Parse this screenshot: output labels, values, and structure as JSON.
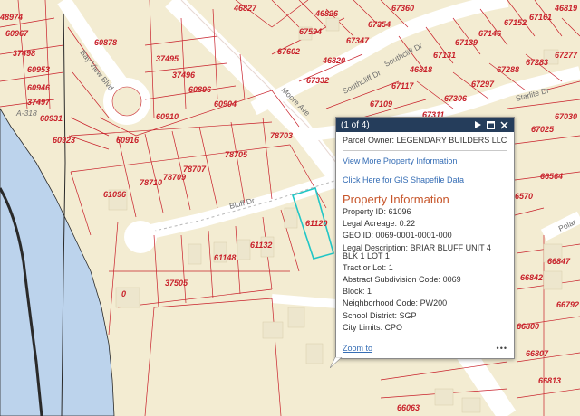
{
  "map": {
    "parcel_labels": [
      "46827",
      "46826",
      "67360",
      "46819",
      "67161",
      "67152",
      "67354",
      "67594",
      "67347",
      "67602",
      "46820",
      "67146",
      "67139",
      "67131",
      "67277",
      "67288",
      "67283",
      "67332",
      "46818",
      "67297",
      "67306",
      "67117",
      "67109",
      "67311",
      "67030",
      "67025",
      "66564",
      "6570",
      "66847",
      "66842",
      "66792",
      "66800",
      "66807",
      "66813",
      "66063",
      "48974",
      "60967",
      "37498",
      "60953",
      "60946",
      "37497",
      "60931",
      "60923",
      "60878",
      "37495",
      "37496",
      "60896",
      "60904",
      "60910",
      "60916",
      "78703",
      "78705",
      "78707",
      "78709",
      "78710",
      "61096",
      "61120",
      "61132",
      "61148",
      "37505",
      "0"
    ],
    "street_labels": [
      "Bay View Blvd",
      "Southcliff Dr",
      "Southcliff Dr",
      "Moore Ave",
      "Starlite Dr",
      "Bluff Dr",
      "Polar",
      "A-318"
    ]
  },
  "popup": {
    "count": "(1 of 4)",
    "owner_label": "Parcel Owner:",
    "owner_value": "LEGENDARY BUILDERS LLC",
    "link_view_more": "View More Property Information",
    "link_shapefile": "Click Here for GIS Shapefile Data",
    "heading": "Property Information",
    "fields": [
      {
        "label": "Property ID:",
        "value": "61096"
      },
      {
        "label": "Legal Acreage:",
        "value": "0.22"
      },
      {
        "label": "GEO ID:",
        "value": "0069-0001-0001-000"
      },
      {
        "label": "Legal Description:",
        "value": "BRIAR BLUFF UNIT 4 BLK 1 LOT 1"
      },
      {
        "label": "Tract or Lot:",
        "value": "1"
      },
      {
        "label": "Abstract Subdivision Code:",
        "value": "0069"
      },
      {
        "label": "Block:",
        "value": "1"
      },
      {
        "label": "Neighborhood Code:",
        "value": "PW200"
      },
      {
        "label": "School District:",
        "value": "SGP"
      },
      {
        "label": "City Limits:",
        "value": "CPO"
      }
    ],
    "zoom_label": "Zoom to",
    "more_label": "•••"
  },
  "colors": {
    "water": "#bcd3ec",
    "land": "#f3ecd2",
    "road": "#ffffff",
    "parcel_line": "#c8202a",
    "building": "#ede6cd",
    "selected": "#21c6c6",
    "popup_header": "#253d5b",
    "heading": "#c7562b",
    "link": "#356db5"
  }
}
